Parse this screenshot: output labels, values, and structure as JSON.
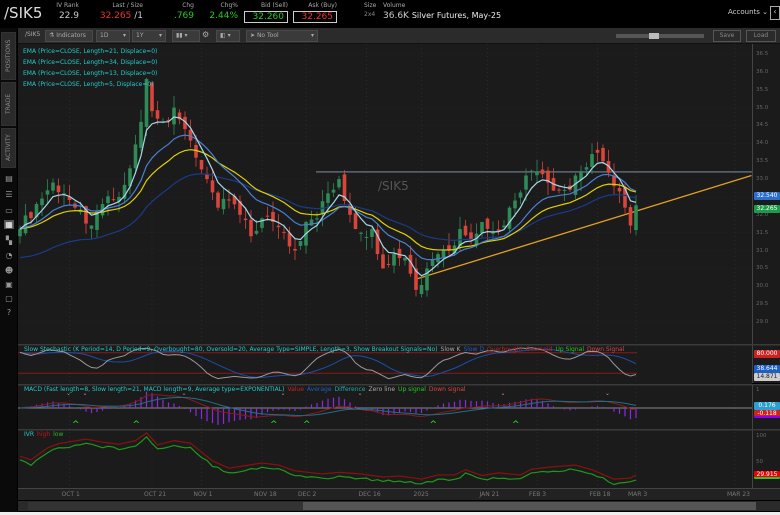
{
  "header": {
    "symbol": "/SIK5",
    "iv_rank_label": "IV Rank",
    "iv_rank": "22.9",
    "last_label": "Last / Size",
    "last": "32.265",
    "last_size": "/1",
    "chg_label": "Chg",
    "chg": ".769",
    "chgpct_label": "Chg%",
    "chgpct": "2.44%",
    "bid_label": "Bid (Sell)",
    "bid": "32.260",
    "ask_label": "Ask (Buy)",
    "ask": "32.265",
    "size_label": "Size",
    "size": "2x4",
    "volume_label": "Volume",
    "volume": "36.6K",
    "description": "Silver Futures, May-25",
    "accounts": "Accounts"
  },
  "toolbar": {
    "symbol": "/SIK5",
    "indicators": "Indicators",
    "aggregation": "1D",
    "timeframe": "1Y",
    "drawing_tool": "No Tool",
    "save": "Save",
    "load": "Load"
  },
  "sidebar": {
    "tabs": [
      "POSITIONS",
      "TRADE",
      "ACTIVITY"
    ]
  },
  "legend": {
    "ema": [
      "EMA (Price=CLOSE, Length=21, Displace=0)",
      "EMA (Price=CLOSE, Length=34, Displace=0)",
      "EMA (Price=CLOSE, Length=13, Displace=0)",
      "EMA (Price=CLOSE, Length=5, Displace=0)"
    ],
    "stoch": {
      "title": "Slow Stochastic (K Period=14, D Period=9, Overbought=80, Oversold=20, Average Type=SIMPLE, Length=3, Show Breakout Signals=No)",
      "items": [
        "Slow K",
        "Slow D",
        "Overbought",
        "Oversold",
        "Up Signal",
        "Down Signal"
      ]
    },
    "macd": {
      "title": "MACD (Fast length=8, Slow length=21, MACD length=9, Average type=EXPONENTIAL)",
      "items": [
        "Value",
        "Average",
        "Difference",
        "Zero line",
        "Up signal",
        "Down signal"
      ]
    },
    "ivr": {
      "items": [
        "IVR",
        "high",
        "low"
      ]
    }
  },
  "watermark": "/SIK5",
  "colors": {
    "up": "#2e8b57",
    "down": "#d9453b",
    "ema5": "#a8d8ea",
    "ema13": "#4a7fd4",
    "ema21": "#e0d000",
    "ema34": "#1a3a8a",
    "trend": "#e0a020",
    "hline": "#5a6a78"
  },
  "chart_data": {
    "type": "candlestick",
    "close_keypoints": [
      [
        0,
        31.6
      ],
      [
        3,
        32.3
      ],
      [
        6,
        32.9
      ],
      [
        8,
        32.6
      ],
      [
        10,
        32.2
      ],
      [
        13,
        31.7
      ],
      [
        15,
        32.3
      ],
      [
        18,
        32.5
      ],
      [
        20,
        33.3
      ],
      [
        22,
        34.6
      ],
      [
        23,
        35.8
      ],
      [
        24,
        34.9
      ],
      [
        26,
        34.6
      ],
      [
        28,
        35.0
      ],
      [
        30,
        34.4
      ],
      [
        32,
        33.6
      ],
      [
        34,
        33.0
      ],
      [
        36,
        32.2
      ],
      [
        38,
        32.4
      ],
      [
        40,
        32.0
      ],
      [
        42,
        31.4
      ],
      [
        44,
        31.9
      ],
      [
        46,
        31.8
      ],
      [
        48,
        31.5
      ],
      [
        50,
        31.0
      ],
      [
        52,
        31.8
      ],
      [
        54,
        31.9
      ],
      [
        56,
        32.6
      ],
      [
        58,
        33.0
      ],
      [
        60,
        32.0
      ],
      [
        62,
        31.5
      ],
      [
        64,
        31.6
      ],
      [
        66,
        30.5
      ],
      [
        68,
        30.9
      ],
      [
        70,
        30.8
      ],
      [
        72,
        29.9
      ],
      [
        74,
        30.5
      ],
      [
        76,
        30.9
      ],
      [
        78,
        31.0
      ],
      [
        80,
        31.6
      ],
      [
        82,
        31.3
      ],
      [
        84,
        31.8
      ],
      [
        86,
        31.5
      ],
      [
        88,
        31.7
      ],
      [
        90,
        32.4
      ],
      [
        92,
        33.1
      ],
      [
        94,
        33.2
      ],
      [
        96,
        32.9
      ],
      [
        98,
        32.7
      ],
      [
        100,
        32.7
      ],
      [
        102,
        33.2
      ],
      [
        104,
        33.7
      ],
      [
        106,
        33.5
      ],
      [
        108,
        32.8
      ],
      [
        110,
        32.2
      ],
      [
        111,
        31.7
      ],
      [
        112,
        32.265
      ]
    ],
    "y_ticks": [
      "36.5",
      "36.0",
      "35.5",
      "35.0",
      "34.5",
      "34.0",
      "33.5",
      "33.0",
      "32.5",
      "32.0",
      "31.5",
      "31.0",
      "30.5",
      "30.0",
      "29.5",
      "29.0"
    ],
    "ylim": [
      29.0,
      36.5
    ],
    "horizontal_line": 33.2,
    "trendline": [
      [
        72,
        30.2
      ],
      [
        133,
        33.1
      ]
    ],
    "price_labels": {
      "ema": "32.540",
      "last": "32.265"
    },
    "stoch_labels": {
      "overbought": "80.000",
      "slow_d": "38.644",
      "slow_k": "14.871"
    },
    "macd_labels": {
      "top": "1",
      "average": "0.176",
      "value": "-0.118"
    },
    "macd_signals": {
      "down": [
        9,
        12,
        30,
        48,
        62,
        88,
        107
      ],
      "up": [
        10,
        21,
        46,
        52,
        75,
        90
      ]
    },
    "ivr_ticks": [
      "100",
      "50"
    ],
    "ivr_label": "29.915",
    "ivr_high_keypoints": [
      [
        0,
        63
      ],
      [
        2,
        56
      ],
      [
        5,
        79
      ],
      [
        7,
        87
      ],
      [
        12,
        96
      ],
      [
        15,
        90
      ],
      [
        18,
        86
      ],
      [
        21,
        93
      ],
      [
        23,
        108
      ],
      [
        25,
        85
      ],
      [
        28,
        93
      ],
      [
        31,
        88
      ],
      [
        35,
        54
      ],
      [
        38,
        40
      ],
      [
        44,
        50
      ],
      [
        47,
        46
      ],
      [
        50,
        35
      ],
      [
        55,
        29
      ],
      [
        58,
        32
      ],
      [
        62,
        29
      ],
      [
        66,
        23
      ],
      [
        69,
        25
      ],
      [
        73,
        19
      ],
      [
        76,
        27
      ],
      [
        79,
        27
      ],
      [
        81,
        37
      ],
      [
        84,
        26
      ],
      [
        87,
        31
      ],
      [
        91,
        27
      ],
      [
        93,
        38
      ],
      [
        96,
        42
      ],
      [
        101,
        46
      ],
      [
        104,
        37
      ],
      [
        108,
        19
      ],
      [
        111,
        21
      ],
      [
        112,
        27
      ]
    ],
    "x_labels": [
      [
        "OCT 1",
        9
      ],
      [
        "OCT 21",
        24
      ],
      [
        "NOV 1",
        33
      ],
      [
        "NOV 18",
        44
      ],
      [
        "DEC 2",
        52
      ],
      [
        "DEC 16",
        63
      ],
      [
        "2025",
        73
      ],
      [
        "JAN 21",
        85
      ],
      [
        "FEB 3",
        94
      ],
      [
        "FEB 18",
        105
      ],
      [
        "MAR 3",
        112
      ],
      [
        "MAR 23",
        130
      ]
    ]
  }
}
